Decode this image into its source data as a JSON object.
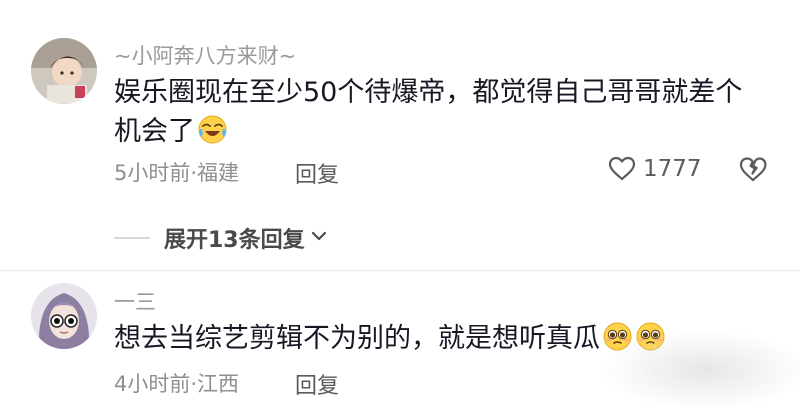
{
  "comments": [
    {
      "username": "~小阿奔八方来财~",
      "content_line1": "娱乐圈现在至少50个待爆帝，都觉得自己哥哥就差个",
      "content_line2": "机会了",
      "emoji_icons": [
        "crying-laughing-emoji-icon"
      ],
      "time_location": "5小时前·福建",
      "reply_label": "回复",
      "likes": "1777",
      "replies_toggle": "展开13条回复"
    },
    {
      "username": "一三",
      "content": "想去当综艺剪辑不为别的，就是想听真瓜",
      "emoji_icons": [
        "pleading-face-emoji-icon",
        "pleading-face-emoji-icon"
      ],
      "time_location": "4小时前·江西",
      "reply_label": "回复"
    }
  ],
  "colors": {
    "text_primary": "#161823",
    "text_secondary": "#8f8f8f",
    "divider": "#ececec"
  }
}
